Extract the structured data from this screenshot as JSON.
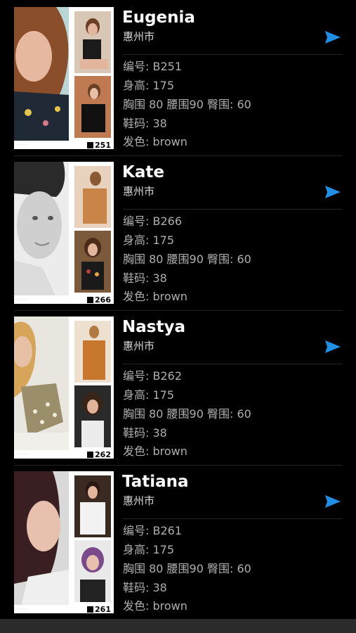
{
  "models": [
    {
      "name": "Eugenia",
      "city": "惠州市",
      "number_label": "编号: B251",
      "height_label": "身高: 175",
      "measurements_label": "胸围 80 腰围90 臀围: 60",
      "shoe_label": "鞋码: 38",
      "hair_label": "发色: brown",
      "comp_card_number": "251",
      "icon": "send-arrow-icon"
    },
    {
      "name": "Kate",
      "city": "惠州市",
      "number_label": "编号: B266",
      "height_label": "身高: 175",
      "measurements_label": "胸围 80 腰围90 臀围: 60",
      "shoe_label": "鞋码: 38",
      "hair_label": "发色: brown",
      "comp_card_number": "266",
      "icon": "send-arrow-icon"
    },
    {
      "name": "Nastya",
      "city": "惠州市",
      "number_label": "编号: B262",
      "height_label": "身高: 175",
      "measurements_label": "胸围 80 腰围90 臀围: 60",
      "shoe_label": "鞋码: 38",
      "hair_label": "发色: brown",
      "comp_card_number": "262",
      "icon": "send-arrow-icon"
    },
    {
      "name": "Tatiana",
      "city": "惠州市",
      "number_label": "编号: B261",
      "height_label": "身高: 175",
      "measurements_label": "胸围 80 腰围90 臀围: 60",
      "shoe_label": "鞋码: 38",
      "hair_label": "发色: brown",
      "comp_card_number": "261",
      "icon": "send-arrow-icon"
    }
  ],
  "colors": {
    "background": "#000000",
    "accent": "#1f8fe6",
    "name_text": "#ffffff",
    "info_text": "#aeaeae"
  }
}
